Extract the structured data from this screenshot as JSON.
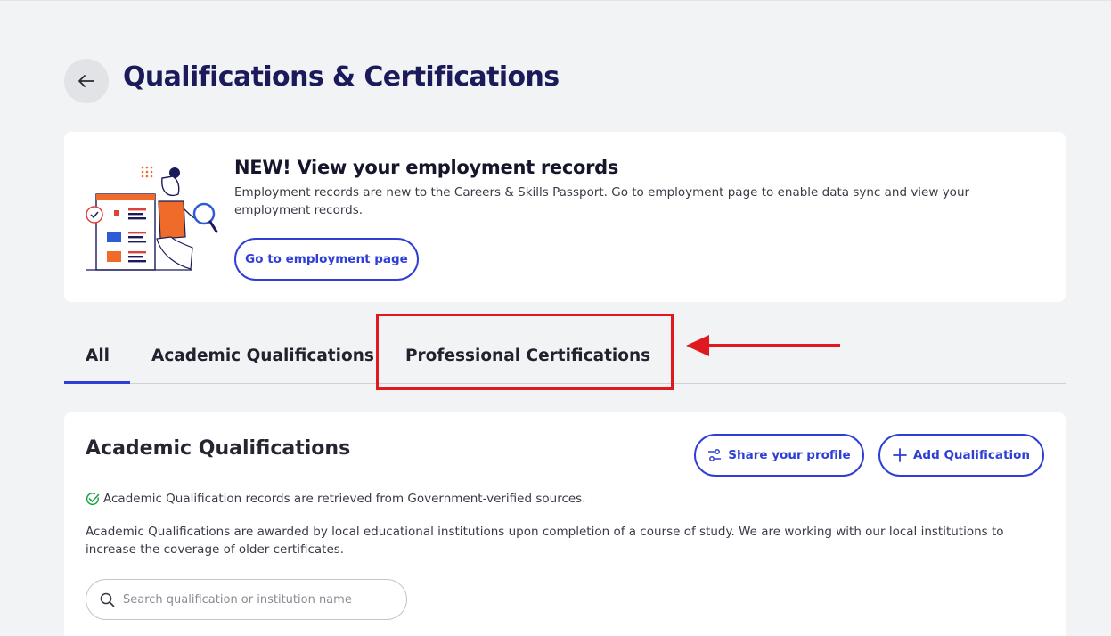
{
  "header": {
    "title": "Qualifications & Certifications",
    "back_icon": "arrow-left-icon"
  },
  "banner": {
    "title": "NEW! View your employment records",
    "text": "Employment records are new to the Careers & Skills Passport. Go to employment page to enable data sync and view your employment records.",
    "button_label": "Go to employment page"
  },
  "tabs": [
    {
      "label": "All",
      "active": true
    },
    {
      "label": "Academic Qualifications",
      "active": false
    },
    {
      "label": "Professional Certifications",
      "active": false
    }
  ],
  "section": {
    "title": "Academic Qualifications",
    "share_label": "Share your profile",
    "add_label": "Add Qualification",
    "verified_text": "Academic Qualification records are retrieved from Government-verified sources.",
    "description": "Academic Qualifications are awarded by local educational institutions upon completion of a course of study. We are working with our local institutions to increase the coverage of older certificates.",
    "search_placeholder": "Search qualification or institution name"
  },
  "colors": {
    "accent": "#2f3fd6",
    "title": "#1b1b5c",
    "annotation": "#e0191e",
    "background": "#f2f3f5"
  }
}
